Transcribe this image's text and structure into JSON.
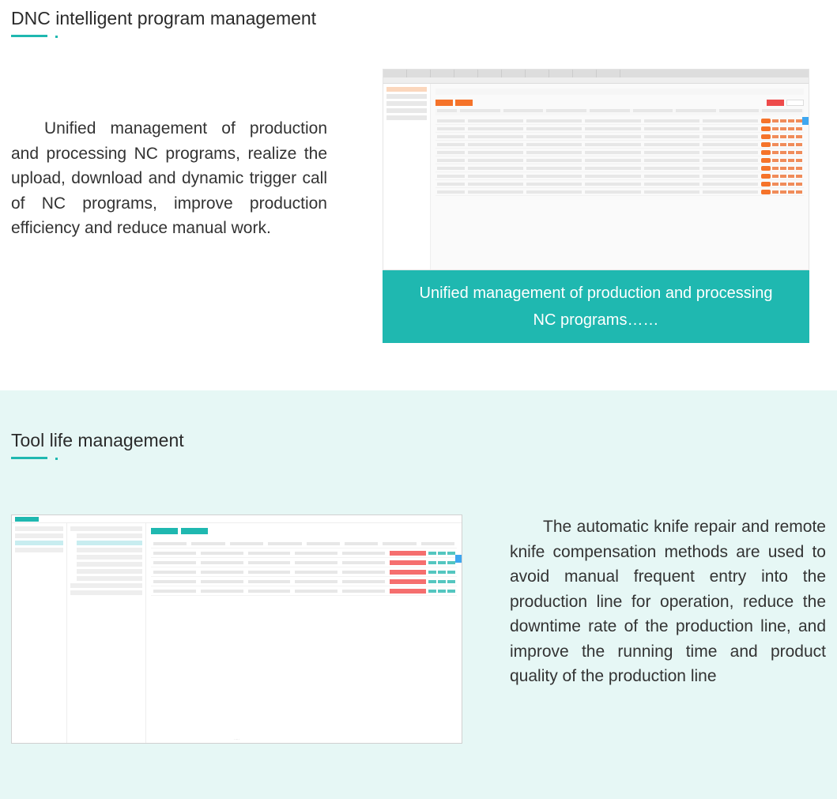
{
  "section1": {
    "heading": "DNC intelligent program management",
    "paragraph": "Unified management of production and processing NC programs, realize the upload, download and dynamic trigger call of NC programs, improve production efficiency and reduce manual work.",
    "caption": "Unified management of production and processing NC programs……"
  },
  "section2": {
    "heading": "Tool life management",
    "paragraph": "The automatic knife repair and remote knife compensation methods are used to avoid manual frequent entry into the production line for operation, reduce the downtime rate of the production line, and improve the running time and product quality of the production line"
  }
}
